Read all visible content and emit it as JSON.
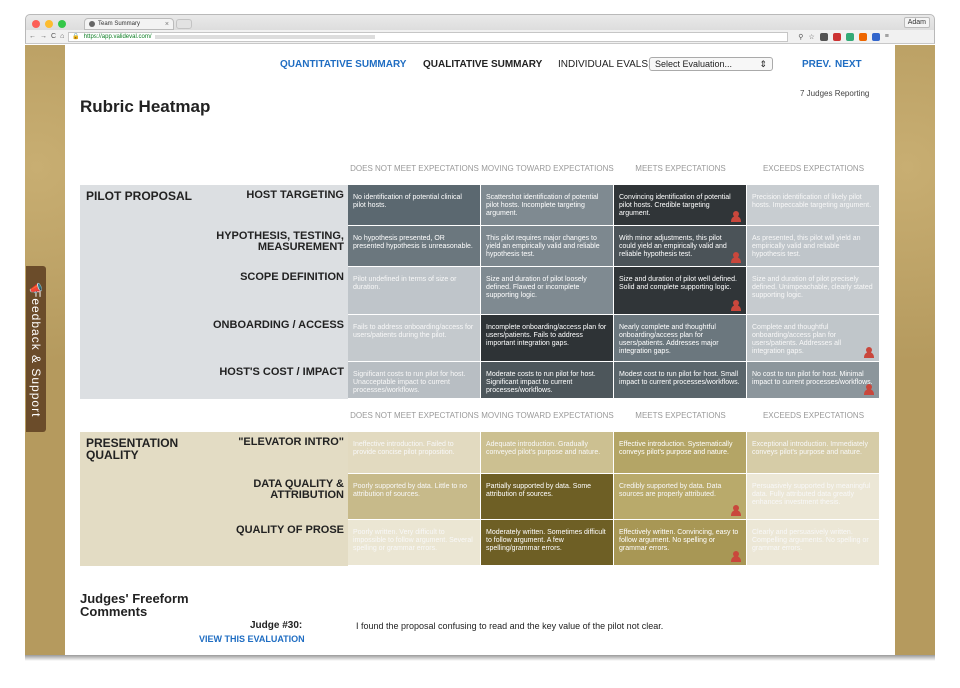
{
  "browser": {
    "tab_title": "Team Summary",
    "url": "https://app.valideval.com/",
    "user": "Adam"
  },
  "nav": {
    "quant": "QUANTITATIVE SUMMARY",
    "qual": "QUALITATIVE SUMMARY",
    "individual_label": "INDIVIDUAL EVALS:",
    "select_value": "Select Evaluation...",
    "prev": "PREV.",
    "next": "NEXT"
  },
  "page_title": "Rubric Heatmap",
  "judges_reporting": "7 Judges Reporting",
  "feedback_tab": "Feedback & Support",
  "columns": [
    "DOES NOT MEET EXPECTATIONS",
    "MOVING TOWARD EXPECTATIONS",
    "MEETS EXPECTATIONS",
    "EXCEEDS EXPECTATIONS"
  ],
  "sections": [
    {
      "name": "PILOT PROPOSAL",
      "rows": [
        {
          "label": "HOST TARGETING",
          "cells": [
            "No identification of potential clinical pilot hosts.",
            "Scattershot identification of potential pilot hosts. Incomplete targeting argument.",
            "Convincing identification of potential pilot hosts. Credible targeting argument.",
            "Precision identification of likely pilot hosts. Impeccable targeting argument."
          ]
        },
        {
          "label": "HYPOTHESIS, TESTING, MEASUREMENT",
          "cells": [
            "No hypothesis presented, OR presented hypothesis is unreasonable.",
            "This pilot requires major changes to yield an empirically valid and reliable hypothesis test.",
            "With minor adjustments, this pilot could yield an empirically valid and reliable hypothesis test.",
            "As presented, this pilot will yield an empirically valid and reliable hypothesis test."
          ]
        },
        {
          "label": "SCOPE DEFINITION",
          "cells": [
            "Pilot undefined in terms of size or duration.",
            "Size and duration of pilot loosely defined. Flawed or incomplete supporting logic.",
            "Size and duration of pilot well defined. Solid and complete supporting logic.",
            "Size and duration of pilot precisely defined. Unimpeachable, clearly stated supporting logic."
          ]
        },
        {
          "label": "ONBOARDING / ACCESS",
          "cells": [
            "Fails to address onboarding/access for users/patients during the pilot.",
            "Incomplete onboarding/access plan for users/patients. Fails to address important integration gaps.",
            "Nearly complete and thoughtful onboarding/access plan for users/patients. Addresses major integration gaps.",
            "Complete and thoughtful onboarding/access plan for users/patients. Addresses all integration gaps."
          ]
        },
        {
          "label": "HOST'S COST / IMPACT",
          "cells": [
            "Significant costs to run pilot for host. Unacceptable impact to current processes/workflows.",
            "Moderate costs to run pilot for host. Significant impact to current processes/workflows.",
            "Modest cost to run pilot for host. Small impact to current processes/workflows.",
            "No cost to run pilot for host. Minimal impact to current processes/workflows."
          ]
        }
      ]
    },
    {
      "name": "PRESENTATION QUALITY",
      "rows": [
        {
          "label": "\"ELEVATOR INTRO\"",
          "cells": [
            "Ineffective introduction. Failed to provide concise pilot proposition.",
            "Adequate introduction. Gradually conveyed pilot's purpose and nature.",
            "Effective introduction. Systematically conveys pilot's purpose and nature.",
            "Exceptional introduction. Immediately conveys pilot's purpose and nature."
          ]
        },
        {
          "label": "DATA QUALITY & ATTRIBUTION",
          "cells": [
            "Poorly supported by data. Little to no attribution of sources.",
            "Partially supported by data. Some attribution of sources.",
            "Credibly supported by data. Data sources are properly attributed.",
            "Persuasively supported by meaningful data. Fully attributed data greatly enhances investment thesis."
          ]
        },
        {
          "label": "QUALITY OF PROSE",
          "cells": [
            "Poorly written. Very difficult to impossible to follow argument. Several spelling or grammar errors.",
            "Moderately written. Sometimes difficult to follow argument. A few spelling/grammar errors.",
            "Effectively written. Convincing, easy to follow argument. No spelling or grammar errors.",
            "Clearly and persuasively written. Compelling arguments. No spelling or grammar errors."
          ]
        }
      ]
    }
  ],
  "comments": {
    "title": "Judges' Freeform Comments",
    "judge": "Judge #30:",
    "link": "VIEW THIS EVALUATION",
    "text": "I found the proposal confusing to read and the key value of the pilot not clear."
  },
  "colors": {
    "nav_link": "#1f6dc2",
    "pin": "#c9473c",
    "pilot_label_bg": "#dcdfe2",
    "presentation_label_bg": "#e3dcc4"
  }
}
